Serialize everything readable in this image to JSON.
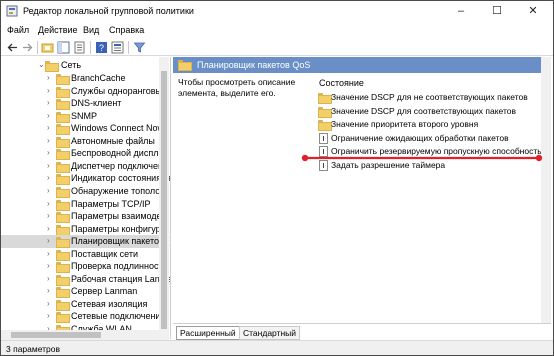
{
  "window": {
    "title": "Редактор локальной групповой политики",
    "minimize": "–",
    "maximize": "☐",
    "close": "✕"
  },
  "menu": [
    "Файл",
    "Действие",
    "Вид",
    "Справка"
  ],
  "tree": {
    "root": "Сеть",
    "items": [
      "BranchCache",
      "Службы одноранговых",
      "DNS-клиент",
      "SNMP",
      "Windows Connect Now",
      "Автономные файлы",
      "Беспроводной дисплей",
      "Диспетчер подключени",
      "Индикатор состояния се",
      "Обнаружение топологи",
      "Параметры TCP/IP",
      "Параметры взаимодей",
      "Параметры конфигура",
      "Планировщик пакетов (",
      "Поставщик сети",
      "Проверка подлинност",
      "Рабочая станция Lanma",
      "Сервер Lanman",
      "Сетевая изоляция",
      "Сетевые подключения",
      "Служба WLAN",
      "Служба WLAN"
    ],
    "selected_index": 13
  },
  "panel": {
    "header": "Планировщик пакетов QoS",
    "description": "Чтобы просмотреть описание элемента, выделите его.",
    "column": "Состояние",
    "items": [
      {
        "label": "Значение DSCP для не соответствующих пакетов",
        "icon": "folder-icon"
      },
      {
        "label": "Значение DSCP для соответствующих пакетов",
        "icon": "folder-icon"
      },
      {
        "label": "Значение приоритета второго уровня",
        "icon": "folder-icon"
      },
      {
        "label": "Ограничение ожидающих обработки пакетов",
        "icon": "setting-icon"
      },
      {
        "label": "Ограничить резервируемую пропускную способность",
        "icon": "setting-icon"
      },
      {
        "label": "Задать разрешение таймера",
        "icon": "setting-icon"
      }
    ],
    "tabs": [
      "Расширенный",
      "Стандартный"
    ]
  },
  "status": "3 параметров",
  "colors": {
    "header_bg": "#6a8fc7",
    "annotation": "#e0202a",
    "folder": "#f3cf6a"
  }
}
